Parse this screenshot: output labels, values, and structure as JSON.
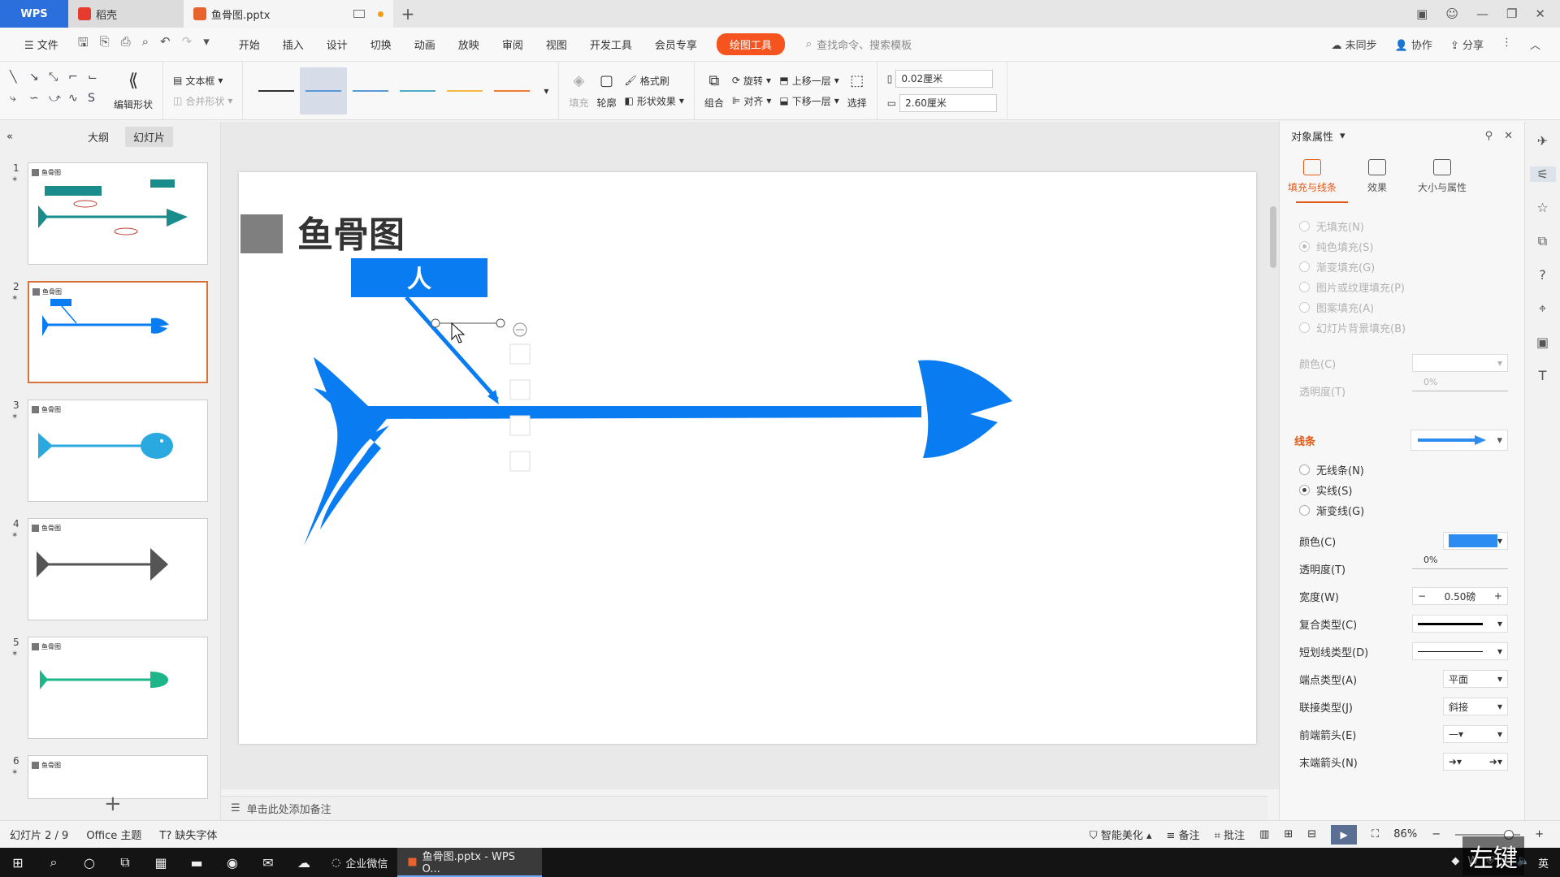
{
  "tabs": {
    "wps": "WPS",
    "daoke": "稻壳",
    "doc": "鱼骨图.pptx"
  },
  "menu": {
    "file": "文件",
    "items": [
      "开始",
      "插入",
      "设计",
      "切换",
      "动画",
      "放映",
      "审阅",
      "视图",
      "开发工具",
      "会员专享"
    ],
    "drawing_tools": "绘图工具",
    "search": "查找命令、搜索模板",
    "unsynced": "未同步",
    "collab": "协作",
    "share": "分享"
  },
  "ribbon": {
    "edit_shape": "编辑形状",
    "textbox": "文本框",
    "merge_shape": "合并形状",
    "fill": "填充",
    "outline": "轮廓",
    "format_painter": "格式刷",
    "shape_effect": "形状效果",
    "group": "组合",
    "rotate": "旋转",
    "align": "对齐",
    "bring_forward": "上移一层",
    "send_backward": "下移一层",
    "select": "选择",
    "height": "0.02厘米",
    "width": "2.60厘米",
    "line_colors": [
      "#333333",
      "#5b9bd5",
      "#5b9bd5",
      "#4bacc6",
      "#f4b942",
      "#ed7d31"
    ]
  },
  "left_panel": {
    "outline_tab": "大纲",
    "slides_tab": "幻灯片",
    "slides": [
      {
        "num": "1",
        "title": "鱼骨图"
      },
      {
        "num": "2",
        "title": "鱼骨图"
      },
      {
        "num": "3",
        "title": "鱼骨图"
      },
      {
        "num": "4",
        "title": "鱼骨图"
      },
      {
        "num": "5",
        "title": "鱼骨图"
      },
      {
        "num": "6",
        "title": "鱼骨图"
      }
    ]
  },
  "slide": {
    "title": "鱼骨图",
    "box_label": "人",
    "fish_color": "#0a7cf2"
  },
  "notes_placeholder": "单击此处添加备注",
  "right_panel": {
    "header": "对象属性",
    "tabs": [
      "填充与线条",
      "效果",
      "大小与属性"
    ],
    "fill_options": [
      "无填充(N)",
      "纯色填充(S)",
      "渐变填充(G)",
      "图片或纹理填充(P)",
      "图案填充(A)",
      "幻灯片背景填充(B)"
    ],
    "fill_color_label": "颜色(C)",
    "fill_transparency_label": "透明度(T)",
    "fill_transparency_value": "0%",
    "line_section": "线条",
    "line_options": [
      "无线条(N)",
      "实线(S)",
      "渐变线(G)"
    ],
    "line_color_label": "颜色(C)",
    "line_color": "#2d8cf0",
    "line_transparency_label": "透明度(T)",
    "line_transparency_value": "0%",
    "width_label": "宽度(W)",
    "width_value": "0.50磅",
    "compound_label": "复合类型(C)",
    "dash_label": "短划线类型(D)",
    "cap_label": "端点类型(A)",
    "cap_value": "平面",
    "join_label": "联接类型(J)",
    "join_value": "斜接",
    "begin_arrow_label": "前端箭头(E)",
    "end_arrow_label": "末端箭头(N)"
  },
  "status": {
    "slide_info": "幻灯片 2 / 9",
    "theme": "Office 主题",
    "missing_font": "缺失字体",
    "beautify": "智能美化",
    "notes": "备注",
    "comments": "批注",
    "zoom": "86%"
  },
  "taskbar": {
    "wecom": "企业微信",
    "wps_app": "鱼骨图.pptx - WPS O..."
  },
  "overlay_key": "左键"
}
